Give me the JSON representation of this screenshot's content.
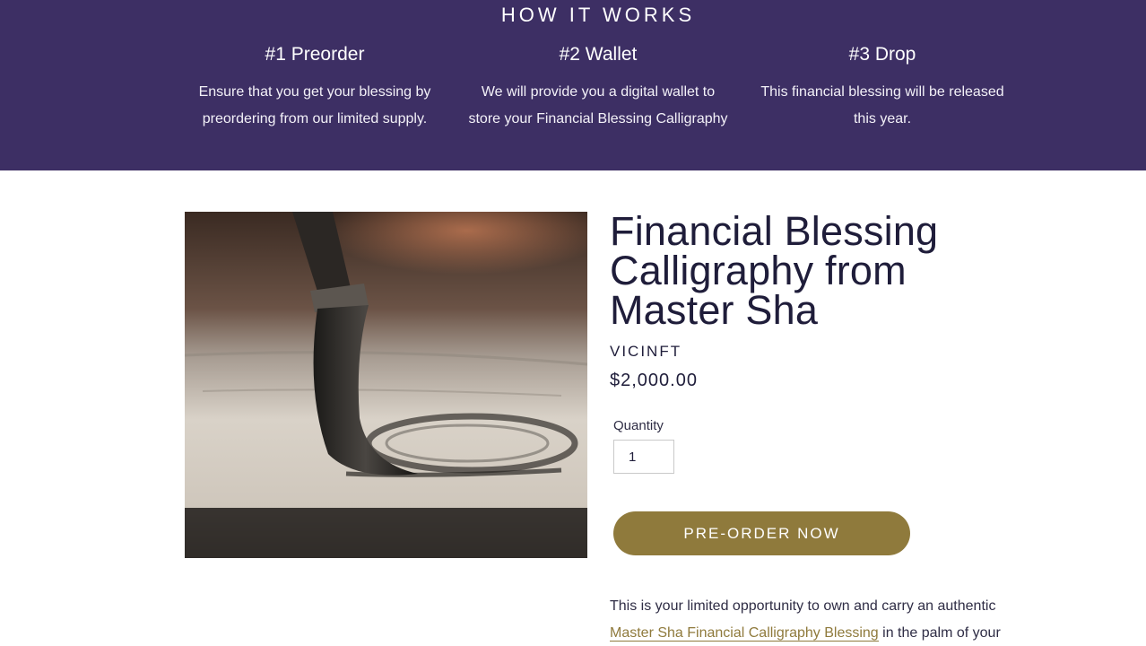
{
  "how_it_works": {
    "title": "HOW IT WORKS",
    "steps": [
      {
        "heading": "#1 Preorder",
        "text": "Ensure that you get your blessing by preordering from our limited supply."
      },
      {
        "heading": "#2 Wallet",
        "text": "We will provide you a digital wallet to store your Financial Blessing Calligraphy"
      },
      {
        "heading": "#3 Drop",
        "text": "This financial blessing will be released this year."
      }
    ]
  },
  "product": {
    "title": "Financial Blessing Calligraphy from Master Sha",
    "vendor": "VICINFT",
    "price": "$2,000.00",
    "quantity_label": "Quantity",
    "quantity_value": "1",
    "preorder_label": "PRE-ORDER NOW",
    "description": {
      "before": "This is your limited opportunity to own and carry an authentic ",
      "link": "Master Sha Financial Calligraphy Blessing",
      "after": " in the palm of your hand. Attract"
    }
  },
  "colors": {
    "band_background": "#3d2f64",
    "accent": "#8f7a3c",
    "heading_text": "#1f1d3a"
  }
}
